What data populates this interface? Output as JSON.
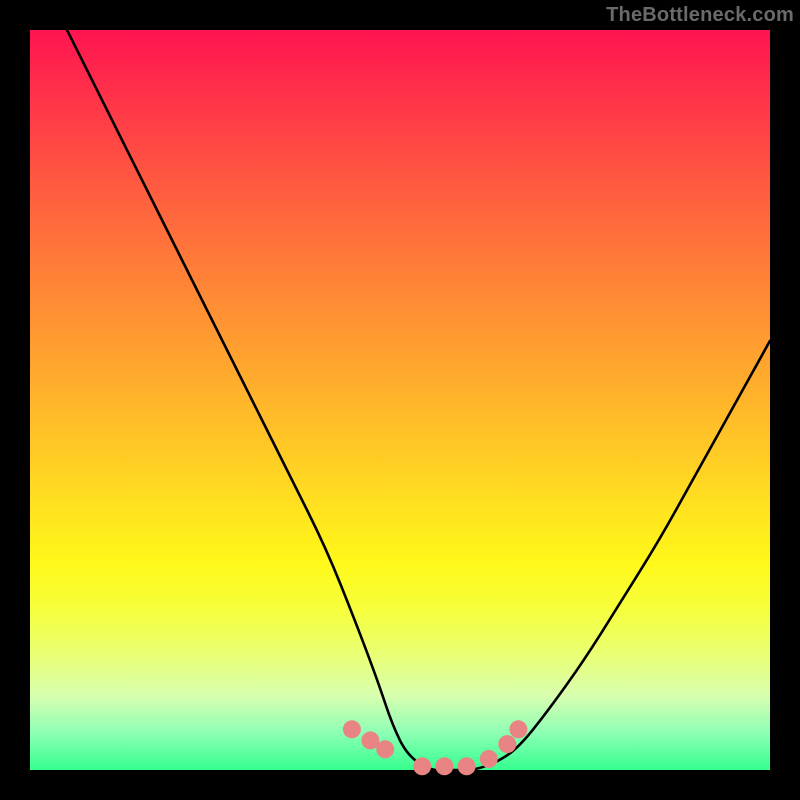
{
  "watermark": "TheBottleneck.com",
  "chart_data": {
    "type": "line",
    "title": "",
    "xlabel": "",
    "ylabel": "",
    "xlim": [
      0,
      100
    ],
    "ylim": [
      0,
      100
    ],
    "grid": false,
    "legend": false,
    "series": [
      {
        "name": "bottleneck-curve",
        "color": "#000000",
        "x": [
          5,
          10,
          15,
          20,
          25,
          30,
          35,
          40,
          44,
          47,
          49,
          51,
          54,
          56,
          58,
          60,
          63,
          66,
          70,
          75,
          80,
          85,
          90,
          95,
          100
        ],
        "values": [
          100,
          90,
          80,
          70,
          60,
          50,
          40,
          30,
          20,
          12,
          6,
          2,
          0,
          0,
          0,
          0,
          1,
          3,
          8,
          15,
          23,
          31,
          40,
          49,
          58
        ]
      }
    ],
    "highlights": {
      "name": "trough-dots",
      "color": "#e98484",
      "x": [
        43.5,
        46,
        48,
        53,
        56,
        59,
        62,
        64.5,
        66
      ],
      "values": [
        5.5,
        4.0,
        2.8,
        0.5,
        0.5,
        0.5,
        1.5,
        3.5,
        5.5
      ]
    }
  }
}
